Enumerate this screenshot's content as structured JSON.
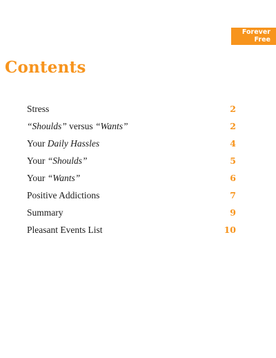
{
  "brand": {
    "line1": "Forever",
    "line2": "Free",
    "color": "#f7941d"
  },
  "title": "Contents",
  "toc": [
    {
      "parts": [
        {
          "text": "Stress",
          "italic": false
        }
      ],
      "page": "2"
    },
    {
      "parts": [
        {
          "text": "“Shoulds”",
          "italic": true
        },
        {
          "text": " versus ",
          "italic": false
        },
        {
          "text": "“Wants”",
          "italic": true
        }
      ],
      "page": "2"
    },
    {
      "parts": [
        {
          "text": "Your ",
          "italic": false
        },
        {
          "text": "Daily Hassles",
          "italic": true
        }
      ],
      "page": "4"
    },
    {
      "parts": [
        {
          "text": "Your ",
          "italic": false
        },
        {
          "text": "“Shoulds”",
          "italic": true
        }
      ],
      "page": "5"
    },
    {
      "parts": [
        {
          "text": "Your ",
          "italic": false
        },
        {
          "text": "“Wants”",
          "italic": true
        }
      ],
      "page": "6"
    },
    {
      "parts": [
        {
          "text": "Positive Addictions",
          "italic": false
        }
      ],
      "page": "7"
    },
    {
      "parts": [
        {
          "text": "Summary",
          "italic": false
        }
      ],
      "page": "9"
    },
    {
      "parts": [
        {
          "text": "Pleasant Events List",
          "italic": false
        }
      ],
      "page": "10"
    }
  ]
}
